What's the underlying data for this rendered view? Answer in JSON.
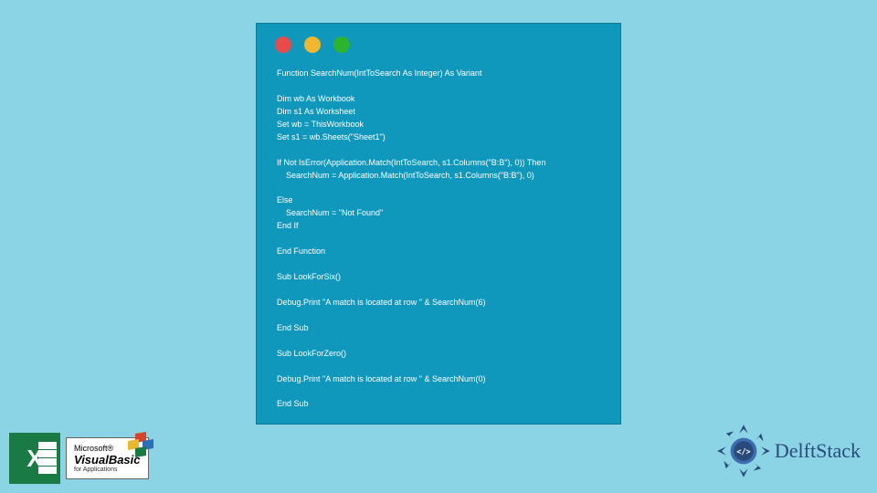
{
  "traffic": {
    "red": "#e94b4b",
    "yellow": "#f2b72c",
    "green": "#2cb52c"
  },
  "code": "Function SearchNum(IntToSearch As Integer) As Variant\n\nDim wb As Workbook\nDim s1 As Worksheet\nSet wb = ThisWorkbook\nSet s1 = wb.Sheets(\"Sheet1\")\n\nIf Not IsError(Application.Match(IntToSearch, s1.Columns(\"B:B\"), 0)) Then\n    SearchNum = Application.Match(IntToSearch, s1.Columns(\"B:B\"), 0)\n\nElse\n    SearchNum = \"Not Found\"\nEnd If\n\nEnd Function\n\nSub LookForSix()\n\nDebug.Print \"A match is located at row \" & SearchNum(6)\n\nEnd Sub\n\nSub LookForZero()\n\nDebug.Print \"A match is located at row \" & SearchNum(0)\n\nEnd Sub",
  "badges": {
    "excel_x": "X",
    "vb_ms": "Microsoft®",
    "vb_main": "VisualBasic",
    "vb_sub": "for Applications",
    "delft_text": "DelftStack",
    "delft_code": "</>"
  }
}
